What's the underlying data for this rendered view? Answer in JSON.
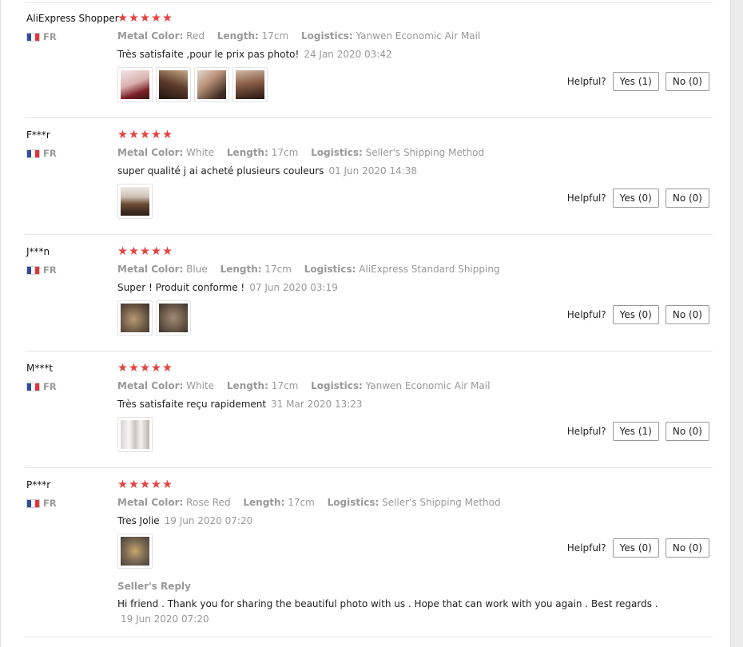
{
  "labels": {
    "metal_color": "Metal Color:",
    "length": "Length:",
    "logistics": "Logistics:",
    "helpful": "Helpful?"
  },
  "reviews": [
    {
      "user": "AliExpress Shopper",
      "country": "FR",
      "rating": 5,
      "metal_color": "Red",
      "length": "17cm",
      "logistics": "Yanwen Economic Air Mail",
      "comment": "Très satisfaite ,pour le prix pas photo!",
      "date": "24 Jan 2020 03:42",
      "photo_count": 4,
      "yes": "Yes (1)",
      "no": "No (0)"
    },
    {
      "user": "F***r",
      "country": "FR",
      "rating": 5,
      "metal_color": "White",
      "length": "17cm",
      "logistics": "Seller's Shipping Method",
      "comment": "super qualité j ai acheté plusieurs couleurs",
      "date": "01 Jun 2020 14:38",
      "photo_count": 1,
      "yes": "Yes (0)",
      "no": "No (0)"
    },
    {
      "user": "J***n",
      "country": "FR",
      "rating": 5,
      "metal_color": "Blue",
      "length": "17cm",
      "logistics": "AliExpress Standard Shipping",
      "comment": "Super ! Produit conforme !",
      "date": "07 Jun 2020 03:19",
      "photo_count": 2,
      "yes": "Yes (0)",
      "no": "No (0)"
    },
    {
      "user": "M***t",
      "country": "FR",
      "rating": 5,
      "metal_color": "White",
      "length": "17cm",
      "logistics": "Yanwen Economic Air Mail",
      "comment": "Très satisfaite reçu rapidement",
      "date": "31 Mar 2020 13:23",
      "photo_count": 1,
      "yes": "Yes (1)",
      "no": "No (0)"
    },
    {
      "user": "P***r",
      "country": "FR",
      "rating": 5,
      "metal_color": "Rose Red",
      "length": "17cm",
      "logistics": "Seller's Shipping Method",
      "comment": "Tres Jolie",
      "date": "19 Jun 2020 07:20",
      "photo_count": 1,
      "yes": "Yes (0)",
      "no": "No (0)",
      "seller_reply": {
        "title": "Seller's Reply",
        "text": "Hi friend . Thank you for sharing the beautiful photo with us . Hope that can work with you again . Best regards .",
        "date": "19 Jun 2020 07:20"
      }
    }
  ],
  "colors": {
    "star": "#e64340",
    "flag_blue": "#2b4ea2",
    "flag_white": "#ffffff",
    "flag_red": "#e0353b",
    "muted_text": "#999999"
  }
}
